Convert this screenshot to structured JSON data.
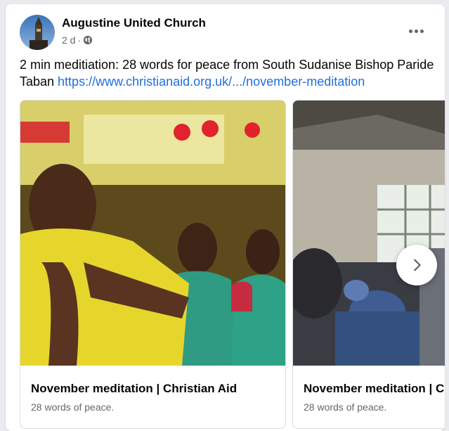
{
  "post": {
    "author": "Augustine United Church",
    "time": "2 d",
    "separator": "·",
    "privacy_icon": "globe-icon",
    "text": "2 min meditiation: 28 words for peace from South Sudanise Bishop Paride Taban ",
    "link": "https://www.christianaid.org.uk/.../november-meditation",
    "more_icon": "more-options-icon"
  },
  "carousel": {
    "cards": [
      {
        "title": "November meditation | Christian Aid",
        "subtitle": "28 words of peace."
      },
      {
        "title": "November meditation | Christian Aid",
        "subtitle": "28 words of peace."
      }
    ],
    "next_icon": "chevron-right-icon"
  },
  "colors": {
    "link": "#216fdb",
    "secondary_text": "#65676b",
    "card_border": "#dadde1"
  }
}
